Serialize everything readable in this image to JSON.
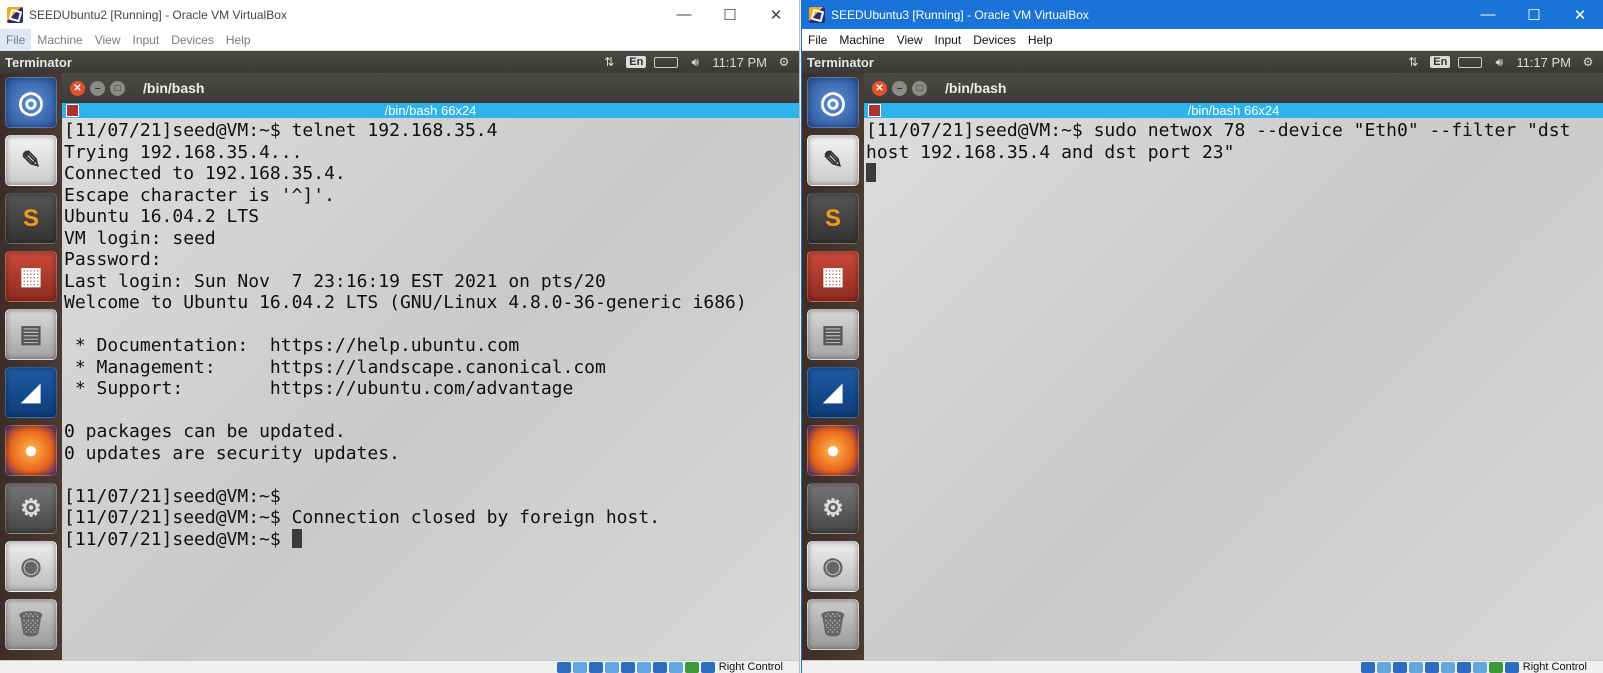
{
  "vm_left": {
    "title": "SEEDUbuntu2 [Running] - Oracle VM VirtualBox",
    "menu": [
      "File",
      "Machine",
      "View",
      "Input",
      "Devices",
      "Help"
    ],
    "topbar": {
      "app": "Terminator",
      "lang": "En",
      "clock": "11:17 PM"
    },
    "terminal": {
      "window_title": "/bin/bash",
      "tab_title": "/bin/bash 66x24",
      "lines": [
        "[11/07/21]seed@VM:~$ telnet 192.168.35.4",
        "Trying 192.168.35.4...",
        "Connected to 192.168.35.4.",
        "Escape character is '^]'.",
        "Ubuntu 16.04.2 LTS",
        "VM login: seed",
        "Password:",
        "Last login: Sun Nov  7 23:16:19 EST 2021 on pts/20",
        "Welcome to Ubuntu 16.04.2 LTS (GNU/Linux 4.8.0-36-generic i686)",
        "",
        " * Documentation:  https://help.ubuntu.com",
        " * Management:     https://landscape.canonical.com",
        " * Support:        https://ubuntu.com/advantage",
        "",
        "0 packages can be updated.",
        "0 updates are security updates.",
        "",
        "[11/07/21]seed@VM:~$",
        "[11/07/21]seed@VM:~$ Connection closed by foreign host.",
        "[11/07/21]seed@VM:~$ "
      ]
    },
    "status_hostkey": "Right Control"
  },
  "vm_right": {
    "title": "SEEDUbuntu3 [Running] - Oracle VM VirtualBox",
    "menu": [
      "File",
      "Machine",
      "View",
      "Input",
      "Devices",
      "Help"
    ],
    "topbar": {
      "app": "Terminator",
      "lang": "En",
      "clock": "11:17 PM"
    },
    "terminal": {
      "window_title": "/bin/bash",
      "tab_title": "/bin/bash 66x24",
      "lines": [
        "[11/07/21]seed@VM:~$ sudo netwox 78 --device \"Eth0\" --filter \"dst",
        "host 192.168.35.4 and dst port 23\"",
        ""
      ]
    },
    "status_hostkey": "Right Control"
  },
  "window_controls": {
    "minimize": "—",
    "maximize": "☐",
    "close": "✕"
  },
  "launcher_icons": [
    "ubuntu-dash-icon",
    "text-editor-icon",
    "sublime-text-icon",
    "terminator-icon",
    "files-icon",
    "wireshark-icon",
    "firefox-icon",
    "system-settings-icon",
    "dvd-icon",
    "trash-icon"
  ],
  "colors": {
    "left_titlebar": "#ffffff",
    "right_titlebar": "#1a73d8",
    "terminal_tabbar": "#2db4ec",
    "launcher_bg": "#45342d"
  }
}
